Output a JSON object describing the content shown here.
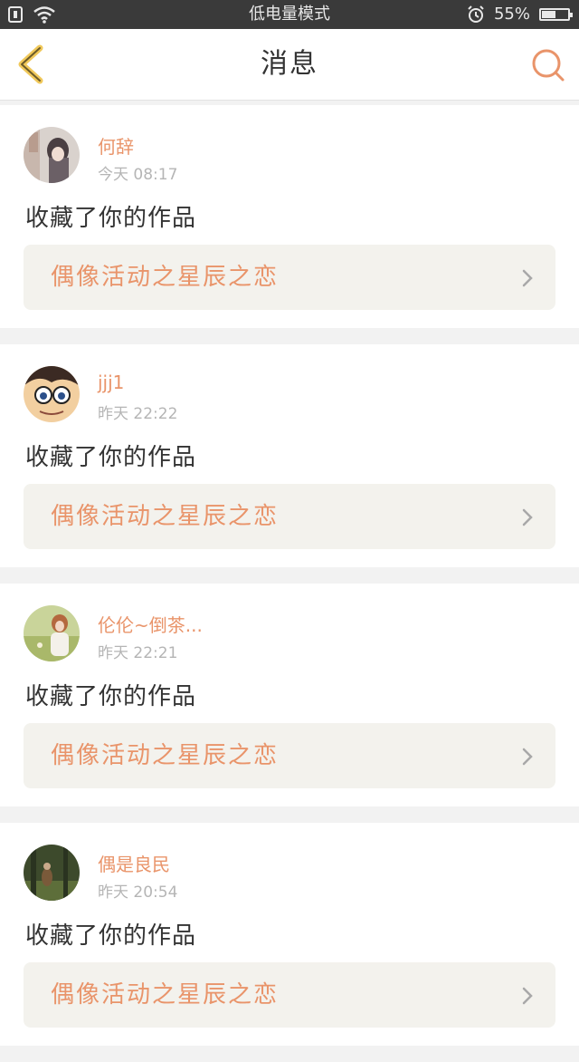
{
  "status_bar": {
    "mode_text": "低电量模式",
    "battery_percent": "55%",
    "battery_level": 0.55
  },
  "header": {
    "title": "消息",
    "back_icon": "chevron-left-icon",
    "search_icon": "search-icon",
    "accent_color": "#e9946a"
  },
  "messages": [
    {
      "user": "何辞",
      "time": "今天 08:17",
      "action": "收藏了你的作品",
      "work": "偶像活动之星辰之恋"
    },
    {
      "user": "jjj1",
      "time": "昨天 22:22",
      "action": "收藏了你的作品",
      "work": "偶像活动之星辰之恋"
    },
    {
      "user": "伦伦~倒茶...",
      "time": "昨天 22:21",
      "action": "收藏了你的作品",
      "work": "偶像活动之星辰之恋"
    },
    {
      "user": "偶是良民",
      "time": "昨天 20:54",
      "action": "收藏了你的作品",
      "work": "偶像活动之星辰之恋"
    }
  ]
}
